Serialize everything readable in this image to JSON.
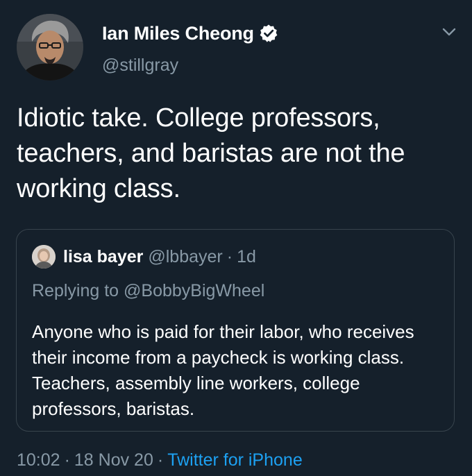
{
  "author": {
    "name": "Ian Miles Cheong",
    "handle": "@stillgray",
    "verified": true,
    "avatar_icon": "profile-photo"
  },
  "menu": {
    "icon": "chevron-down-icon"
  },
  "tweet": {
    "text": "Idiotic take. College professors, teachers, and baristas are not the working class."
  },
  "quoted_tweet": {
    "author_name": "lisa bayer",
    "author_handle": "@lbbayer",
    "separator": "·",
    "time": "1d",
    "replying_to": "Replying to @BobbyBigWheel",
    "text": "Anyone who is paid for their labor, who receives their income from a paycheck is working class. Teachers, assembly line workers, college professors, baristas."
  },
  "meta": {
    "time": "10:02",
    "separator1": "·",
    "date": "18 Nov 20",
    "separator2": "·",
    "source": "Twitter for iPhone"
  },
  "colors": {
    "background": "#15202b",
    "primary_text": "#ffffff",
    "secondary_text": "#8899a6",
    "accent": "#1da1f2",
    "border": "#38444d"
  }
}
